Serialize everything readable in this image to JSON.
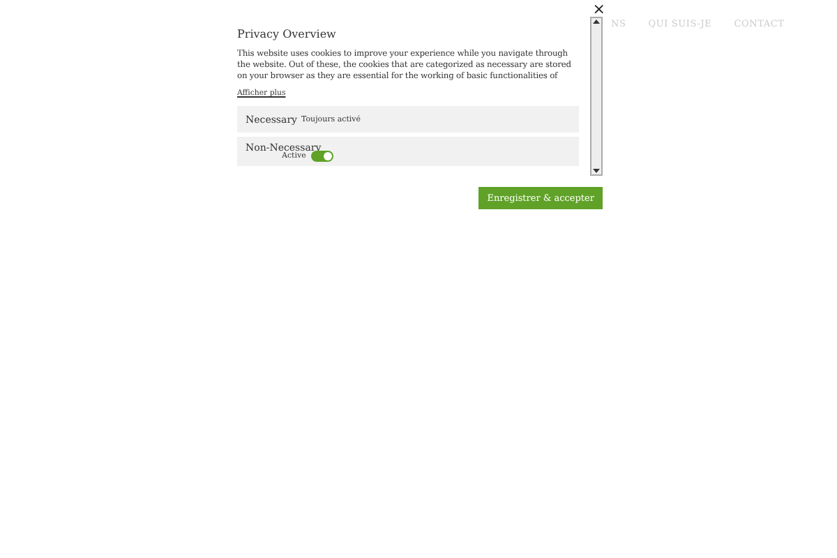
{
  "nav": {
    "items": [
      "NS",
      "QUI SUIS-JE",
      "CONTACT"
    ]
  },
  "modal": {
    "close": "×",
    "title": "Privacy Overview",
    "description": "This website uses cookies to improve your experience while you navigate through the website. Out of these, the cookies that are categorized as necessary are stored on your browser as they are essential for the working of basic functionalities of",
    "more_link": "Afficher plus",
    "categories": [
      {
        "kind": "fixed",
        "name": "Necessary",
        "status": "Toujours activé"
      },
      {
        "kind": "toggle",
        "name": "Non-Necessary",
        "status": "Active",
        "on": true
      }
    ],
    "save_button": "Enregistrer & accepter"
  }
}
